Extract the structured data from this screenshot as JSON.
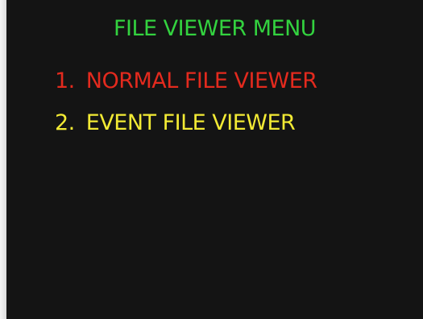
{
  "menu": {
    "title": "FILE VIEWER MENU",
    "items": [
      {
        "number": "1.",
        "label": "NORMAL FILE VIEWER",
        "selected": true
      },
      {
        "number": "2.",
        "label": "EVENT FILE VIEWER",
        "selected": false
      }
    ]
  },
  "colors": {
    "background": "#141414",
    "title": "#33d23f",
    "selected_item": "#e32a1e",
    "unselected_item": "#f2ea34"
  }
}
